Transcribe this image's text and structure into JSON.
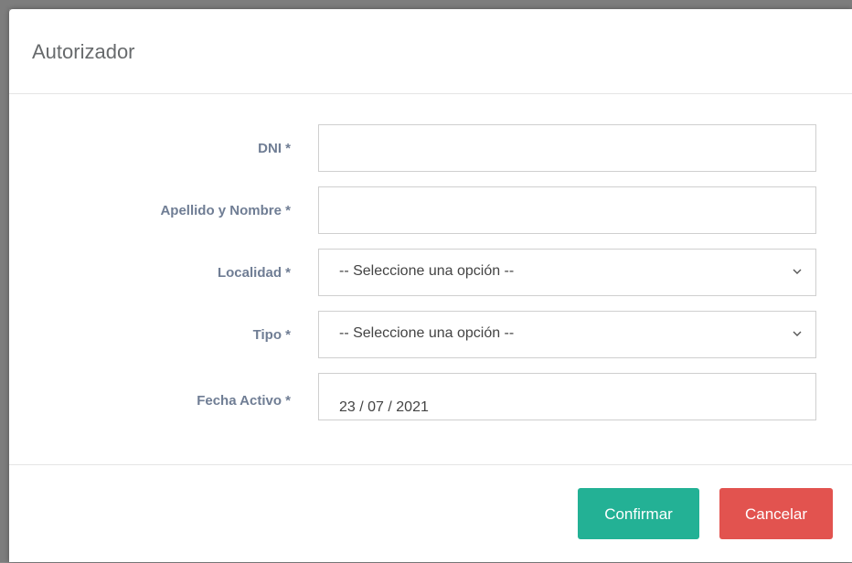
{
  "modal": {
    "title": "Autorizador"
  },
  "form": {
    "dni": {
      "label": "DNI *",
      "value": ""
    },
    "apellido_nombre": {
      "label": "Apellido y Nombre *",
      "value": ""
    },
    "localidad": {
      "label": "Localidad *",
      "selected": "-- Seleccione una opción --"
    },
    "tipo": {
      "label": "Tipo *",
      "selected": "-- Seleccione una opción --"
    },
    "fecha_activo": {
      "label": "Fecha Activo *",
      "value": "23 / 07 / 2021"
    }
  },
  "footer": {
    "confirm_label": "Confirmar",
    "cancel_label": "Cancelar"
  },
  "colors": {
    "confirm": "#23b195",
    "cancel": "#e2534f",
    "label": "#6f7d94"
  },
  "icons": {
    "select_arrow": "chevron-down-icon"
  }
}
